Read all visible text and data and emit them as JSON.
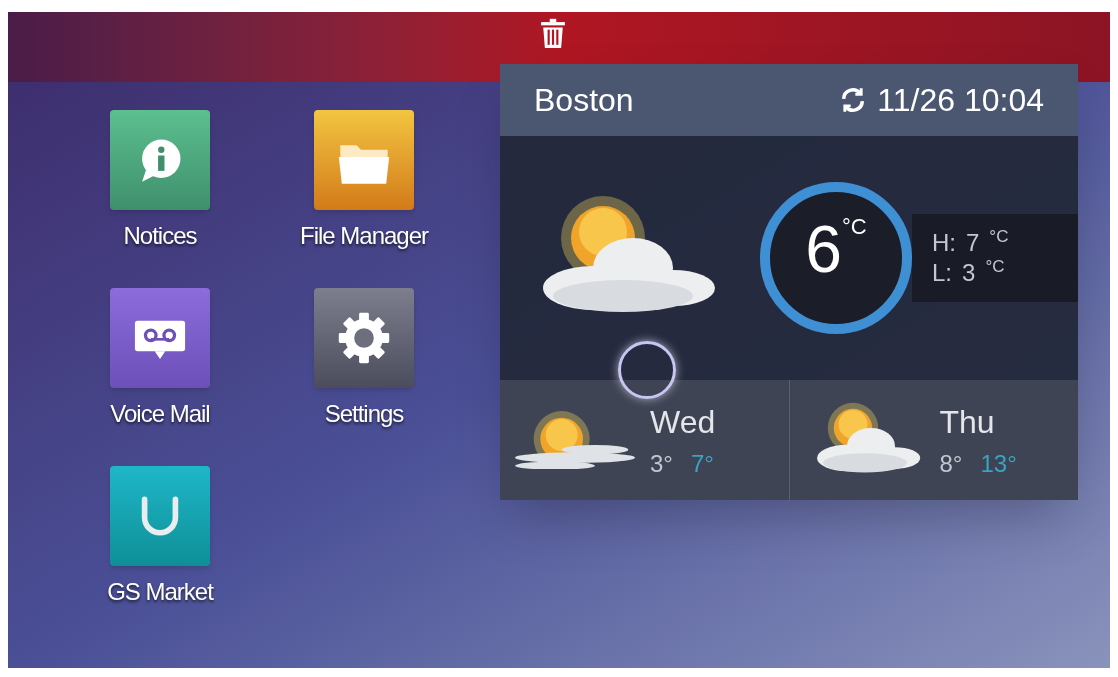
{
  "apps": [
    {
      "label": "Notices",
      "kind": "notices"
    },
    {
      "label": "File Manager",
      "kind": "files"
    },
    {
      "label": "Voice Mail",
      "kind": "voicemail"
    },
    {
      "label": "Settings",
      "kind": "settings"
    },
    {
      "label": "GS Market",
      "kind": "market"
    }
  ],
  "weather_widget": {
    "city": "Boston",
    "updated": "11/26 10:04",
    "current": {
      "temp": "6",
      "unit": "°C",
      "high_label": "H:",
      "high": "7",
      "high_unit": "°C",
      "low_label": "L:",
      "low": "3",
      "low_unit": "°C"
    },
    "forecast": [
      {
        "day": "Wed",
        "low": "3°",
        "high": "7°",
        "kind": "sunny"
      },
      {
        "day": "Thu",
        "low": "8°",
        "high": "13°",
        "kind": "partly_cloudy"
      }
    ]
  }
}
